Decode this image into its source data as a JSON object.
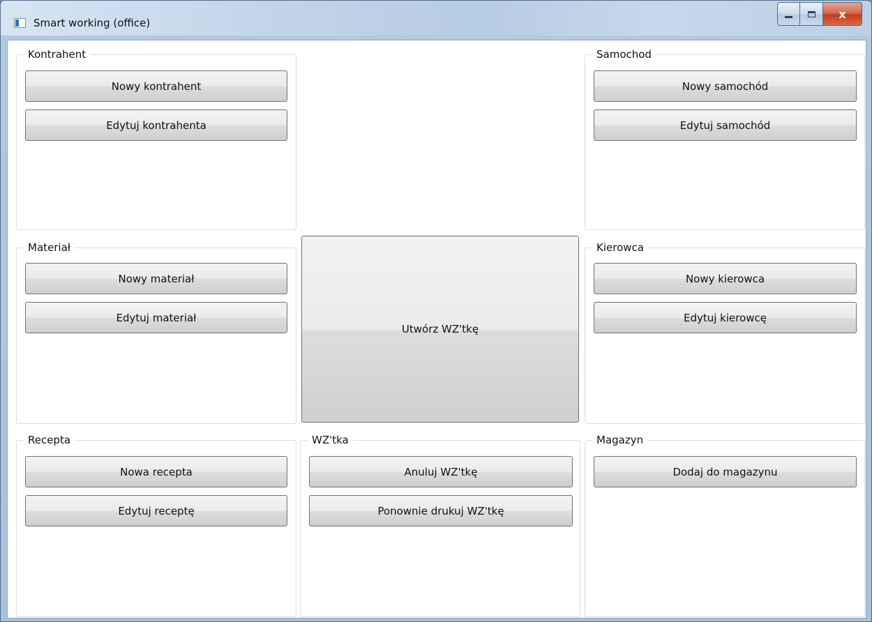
{
  "window": {
    "title": "Smart working (office)",
    "close_glyph": "x"
  },
  "groups": {
    "kontrahent": {
      "label": "Kontrahent",
      "buttons": [
        "Nowy kontrahent",
        "Edytuj kontrahenta"
      ]
    },
    "samochod": {
      "label": "Samochod",
      "buttons": [
        "Nowy samochód",
        "Edytuj samochód"
      ]
    },
    "material": {
      "label": "Materiał",
      "buttons": [
        "Nowy materiał",
        "Edytuj materiał"
      ]
    },
    "kierowca": {
      "label": "Kierowca",
      "buttons": [
        "Nowy kierowca",
        "Edytuj kierowcę"
      ]
    },
    "recepta": {
      "label": "Recepta",
      "buttons": [
        "Nowa recepta",
        "Edytuj receptę"
      ]
    },
    "wztka": {
      "label": "WZ'tka",
      "buttons": [
        "Anuluj WZ'tkę",
        "Ponownie drukuj WZ'tkę"
      ]
    },
    "magazyn": {
      "label": "Magazyn",
      "buttons": [
        "Dodaj do magazynu"
      ]
    }
  },
  "main_action": {
    "label": "Utwórz WZ'tkę"
  }
}
